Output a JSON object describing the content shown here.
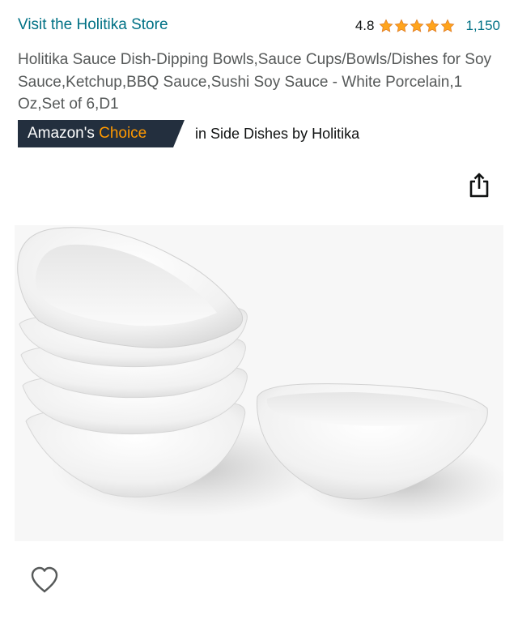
{
  "store": {
    "link_label": "Visit the Holitika Store"
  },
  "rating": {
    "value": "4.8",
    "stars": 5,
    "review_count": "1,150"
  },
  "product": {
    "title": "Holitika Sauce Dish-Dipping Bowls,Sauce Cups/Bowls/Dishes for Soy Sauce,Ketchup,BBQ Sauce,Sushi Soy Sauce - White Porcelain,1 Oz,Set of 6,D1"
  },
  "badge": {
    "brand_text": "Amazon's ",
    "choice_text": "Choice",
    "description": "in Side Dishes by Holitika"
  },
  "icons": {
    "share": "share-icon",
    "wishlist": "heart-icon",
    "star": "star-icon"
  },
  "colors": {
    "link": "#007185",
    "star": "#ffa41c",
    "badge_bg": "#232f3e",
    "badge_accent": "#ff9900",
    "title": "#565959"
  },
  "image": {
    "alt": "White porcelain sauce dishes"
  }
}
